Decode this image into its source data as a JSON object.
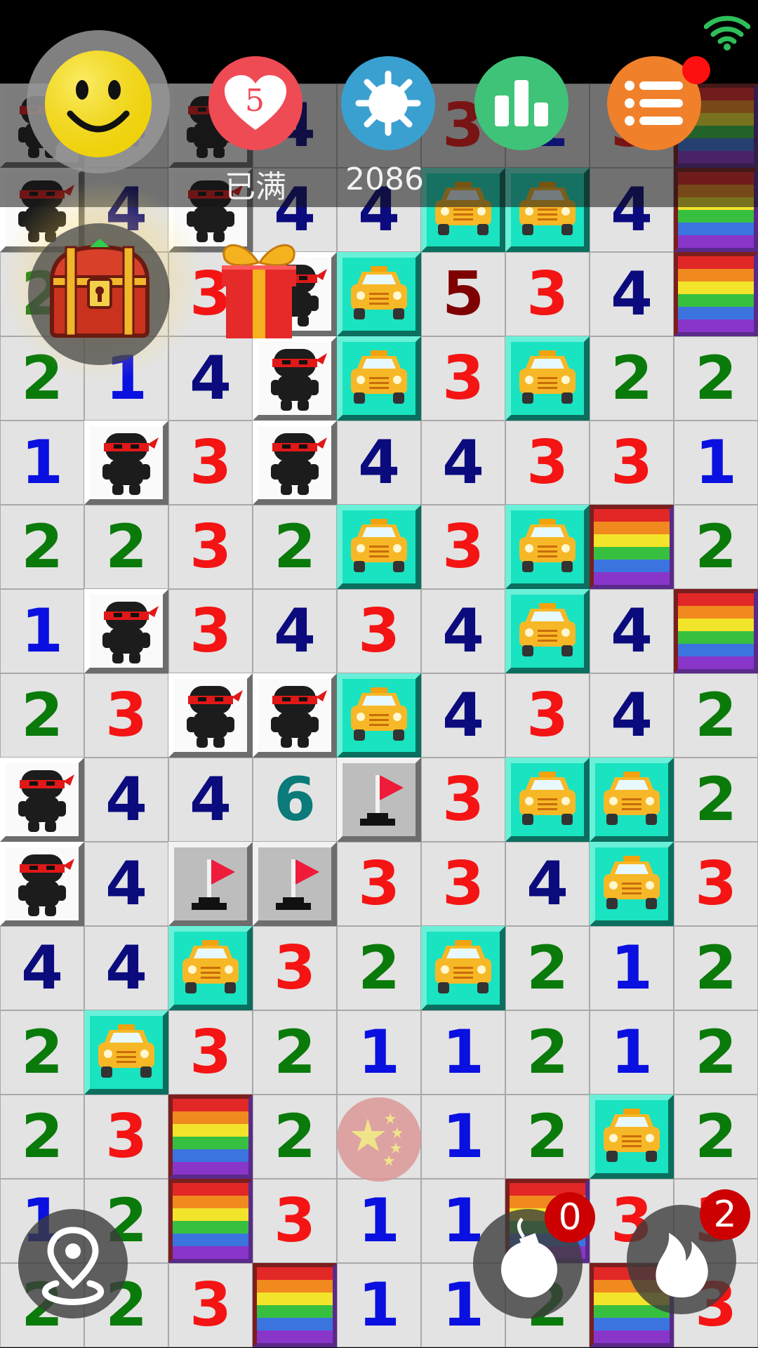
{
  "header": {
    "lives_count": "5",
    "lives_status": "已满",
    "score": "2086",
    "buttons": [
      {
        "name": "mines-settings-button",
        "icon": "mine-icon",
        "color": "#3aa0d0"
      },
      {
        "name": "stats-button",
        "icon": "bar-chart-icon",
        "color": "#3fc378"
      },
      {
        "name": "menu-button",
        "icon": "list-menu-icon",
        "color": "#f0802a"
      }
    ],
    "lives_color": "#ef4b55",
    "smiley_color": "#f5dd10"
  },
  "board": {
    "rows": [
      [
        "ninja",
        "4",
        "ninja",
        "4",
        "4",
        "3",
        "1",
        "3",
        "rainbow"
      ],
      [
        "ninja",
        "4",
        "ninja",
        "4",
        "4",
        "taxi",
        "taxi",
        "4",
        "rainbow"
      ],
      [
        "2",
        "2",
        "3",
        "ninja",
        "taxi",
        "5",
        "3",
        "4",
        "rainbow"
      ],
      [
        "2",
        "1",
        "4",
        "ninja",
        "taxi",
        "3",
        "taxi",
        "2",
        "2"
      ],
      [
        "1",
        "ninja",
        "3",
        "ninja",
        "4",
        "4",
        "3",
        "3",
        "1"
      ],
      [
        "2",
        "2",
        "3",
        "2",
        "taxi",
        "3",
        "taxi",
        "rainbow",
        "2"
      ],
      [
        "1",
        "ninja",
        "3",
        "4",
        "3",
        "4",
        "taxi",
        "4",
        "rainbow"
      ],
      [
        "2",
        "3",
        "ninja",
        "ninja",
        "taxi",
        "4",
        "3",
        "4",
        "2"
      ],
      [
        "ninja",
        "4",
        "4",
        "6",
        "flag",
        "3",
        "taxi",
        "taxi",
        "2"
      ],
      [
        "ninja",
        "4",
        "flag",
        "flag",
        "3",
        "3",
        "4",
        "taxi",
        "3"
      ],
      [
        "4",
        "4",
        "taxi",
        "3",
        "2",
        "taxi",
        "2",
        "1",
        "2"
      ],
      [
        "2",
        "taxi",
        "3",
        "2",
        "1",
        "1",
        "2",
        "1",
        "2"
      ],
      [
        "2",
        "3",
        "rainbow",
        "2",
        "",
        "1",
        "2",
        "taxi",
        "2"
      ],
      [
        "1",
        "2",
        "rainbow",
        "3",
        "1",
        "1",
        "rainbow",
        "3",
        "3"
      ],
      [
        "2",
        "2",
        "3",
        "rainbow",
        "1",
        "1",
        "2",
        "rainbow",
        "3"
      ]
    ],
    "number_colors": {
      "1": "#0a10e0",
      "2": "#0a7a0a",
      "3": "#f41414",
      "4": "#0b0b7e",
      "5": "#7e0000",
      "6": "#0a7a7a"
    }
  },
  "bottom": {
    "bomb_count": "0",
    "fire_count": "2"
  }
}
